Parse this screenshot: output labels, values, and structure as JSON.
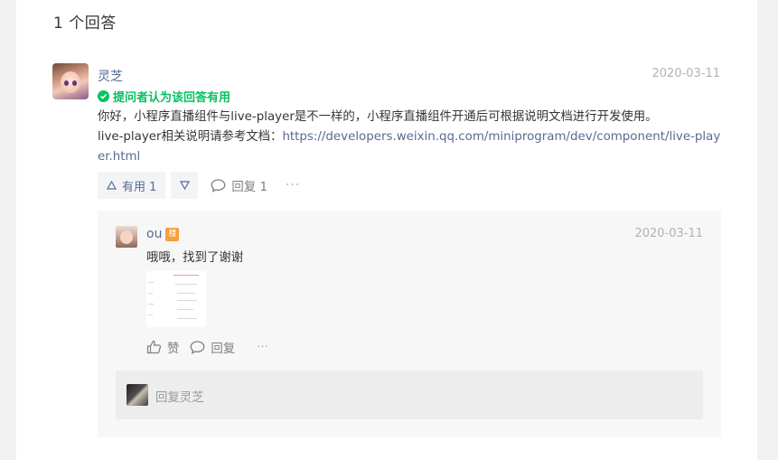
{
  "heading": "1 个回答",
  "answer": {
    "author": "灵芝",
    "date": "2020-03-11",
    "accepted_label": "提问者认为该回答有用",
    "text_line1": "你好，小程序直播组件与live-player是不一样的，小程序直播组件开通后可根据说明文档进行开发使用。",
    "text_prefix": "live-player相关说明请参考文档：",
    "link": "https://developers.weixin.qq.com/miniprogram/dev/component/live-player.html",
    "useful_label": "有用 1",
    "reply_label": "回复 1",
    "more": "···"
  },
  "comment": {
    "author": "ou",
    "badge": "楼",
    "date": "2020-03-11",
    "text": "哦哦，找到了谢谢",
    "like_label": "赞",
    "reply_label": "回复",
    "more": "···"
  },
  "reply_box": {
    "placeholder": "回复灵芝"
  },
  "colors": {
    "link": "#576b95",
    "accepted": "#07c160",
    "badge": "#fa9d3b"
  }
}
